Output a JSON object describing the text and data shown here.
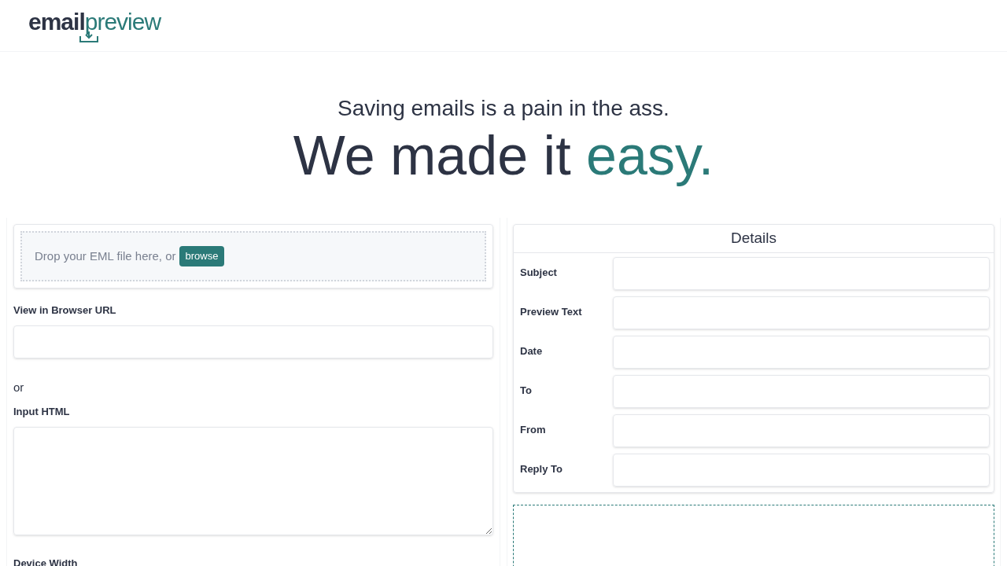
{
  "logo": {
    "dark_part": "email",
    "accent_part": "preview"
  },
  "hero": {
    "tagline": "Saving emails is a pain in the ass.",
    "headline": "We made it",
    "headline_accent": "easy."
  },
  "upload": {
    "prompt": "Drop your EML file here, or",
    "button": "browse"
  },
  "url_field": {
    "label": "View in Browser URL"
  },
  "separator": "or",
  "html_field": {
    "label": "Input HTML"
  },
  "device_width": {
    "label": "Device Width"
  },
  "details": {
    "title": "Details",
    "fields": [
      {
        "label": "Subject"
      },
      {
        "label": "Preview Text"
      },
      {
        "label": "Date"
      },
      {
        "label": "To"
      },
      {
        "label": "From"
      },
      {
        "label": "Reply To"
      }
    ]
  }
}
